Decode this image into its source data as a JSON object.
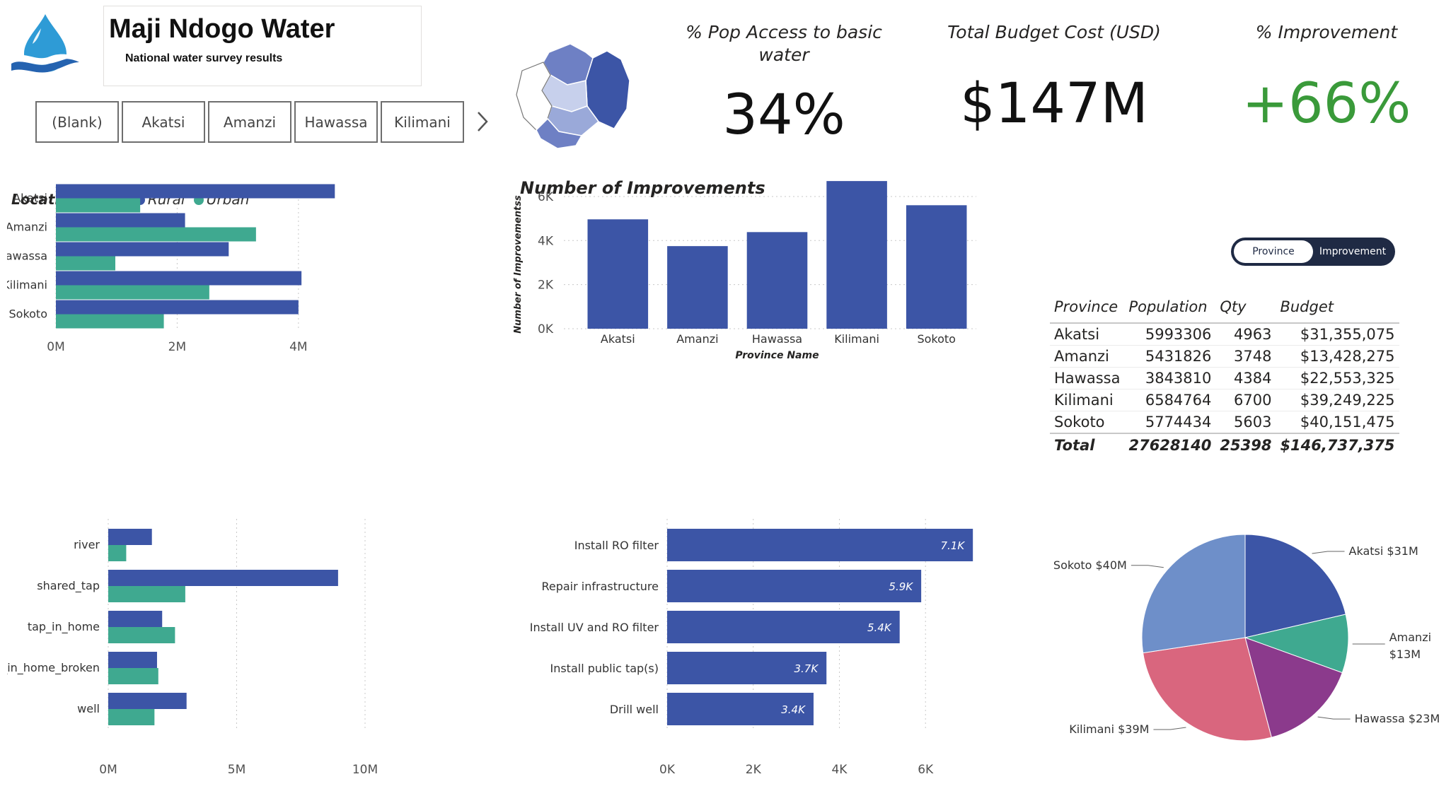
{
  "header": {
    "title": "Maji Ndogo Water",
    "subtitle": "National water survey results",
    "logo_icon": "water-drop-icon"
  },
  "slicer": {
    "items": [
      "(Blank)",
      "Akatsi",
      "Amanzi",
      "Hawassa",
      "Kilimani"
    ],
    "next_icon": "chevron-right-icon"
  },
  "kpis": {
    "access_label": "% Pop Access to basic water",
    "access_value": "34%",
    "budget_label": "Total Budget Cost (USD)",
    "budget_value": "$147M",
    "improvement_label": "% Improvement",
    "improvement_value": "+66%"
  },
  "legend": {
    "title": "Location Type",
    "items": [
      {
        "label": "Rural",
        "color": "#3c55a6"
      },
      {
        "label": "Urban",
        "color": "#3fa990"
      }
    ]
  },
  "toggle": {
    "options": [
      "Province",
      "Improvement"
    ],
    "selected": "Province"
  },
  "table": {
    "columns": [
      "Province",
      "Population",
      "Qty",
      "Budget"
    ],
    "rows": [
      [
        "Akatsi",
        "5993306",
        "4963",
        "$31,355,075"
      ],
      [
        "Amanzi",
        "5431826",
        "3748",
        "$13,428,275"
      ],
      [
        "Hawassa",
        "3843810",
        "4384",
        "$22,553,325"
      ],
      [
        "Kilimani",
        "6584764",
        "6700",
        "$39,249,225"
      ],
      [
        "Sokoto",
        "5774434",
        "5603",
        "$40,151,475"
      ]
    ],
    "total": [
      "Total",
      "27628140",
      "25398",
      "$146,737,375"
    ]
  },
  "colors": {
    "rural": "#3c55a6",
    "urban": "#3fa990",
    "improvement_bar": "#3c55a6",
    "kpi_positive": "#3a9a3a"
  },
  "chart_data": [
    {
      "id": "population-by-province",
      "type": "bar",
      "orientation": "horizontal",
      "categories": [
        "Akatsi",
        "Amanzi",
        "Hawassa",
        "Kilimani",
        "Sokoto"
      ],
      "series": [
        {
          "name": "Rural",
          "values": [
            4600000,
            2130000,
            2850000,
            4050000,
            4000000
          ]
        },
        {
          "name": "Urban",
          "values": [
            1390000,
            3300000,
            980000,
            2530000,
            1780000
          ]
        }
      ],
      "xlim": [
        0,
        4900000
      ],
      "xticks": [
        0,
        2000000,
        4000000
      ],
      "xtick_labels": [
        "0M",
        "2M",
        "4M"
      ],
      "grid": true,
      "legend": "top-left"
    },
    {
      "id": "number-of-improvements",
      "type": "bar",
      "title": "Number of Improvements",
      "xlabel": "Province Name",
      "ylabel": "Number of Improvementss",
      "categories": [
        "Akatsi",
        "Amanzi",
        "Hawassa",
        "Kilimani",
        "Sokoto"
      ],
      "values": [
        4963,
        3748,
        4384,
        6700,
        5603
      ],
      "ylim": [
        0,
        6800
      ],
      "yticks": [
        0,
        2000,
        4000,
        6000
      ],
      "ytick_labels": [
        "0K",
        "2K",
        "4K",
        "6K"
      ],
      "grid": true
    },
    {
      "id": "population-by-source-type",
      "type": "bar",
      "orientation": "horizontal",
      "categories": [
        "river",
        "shared_tap",
        "tap_in_home",
        "tap_in_home_broken",
        "well"
      ],
      "series": [
        {
          "name": "Rural",
          "values": [
            1700000,
            8950000,
            2100000,
            1900000,
            3050000
          ]
        },
        {
          "name": "Urban",
          "values": [
            700000,
            3000000,
            2600000,
            1950000,
            1800000
          ]
        }
      ],
      "xlim": [
        0,
        10000000
      ],
      "xticks": [
        0,
        5000000,
        10000000
      ],
      "xtick_labels": [
        "0M",
        "5M",
        "10M"
      ],
      "grid": true
    },
    {
      "id": "improvement-types",
      "type": "bar",
      "orientation": "horizontal",
      "categories": [
        "Install RO filter",
        "Repair infrastructure",
        "Install UV and RO filter",
        "Install public tap(s)",
        "Drill well"
      ],
      "values": [
        7100,
        5900,
        5400,
        3700,
        3400
      ],
      "data_labels": [
        "7.1K",
        "5.9K",
        "5.4K",
        "3.7K",
        "3.4K"
      ],
      "xlim": [
        0,
        7500
      ],
      "xticks": [
        0,
        2000,
        4000,
        6000
      ],
      "xtick_labels": [
        "0K",
        "2K",
        "4K",
        "6K"
      ],
      "grid": true
    },
    {
      "id": "budget-by-province",
      "type": "pie",
      "categories": [
        "Akatsi",
        "Amanzi",
        "Hawassa",
        "Kilimani",
        "Sokoto"
      ],
      "values": [
        31355075,
        13428275,
        22553325,
        39249225,
        40151475
      ],
      "labels": [
        "Akatsi $31M",
        "Amanzi $13M",
        "Hawassa $23M",
        "Kilimani $39M",
        "Sokoto $40M"
      ],
      "colors": [
        "#3c55a6",
        "#3fa990",
        "#8b3a8c",
        "#d9667e",
        "#6e8fc9"
      ]
    }
  ]
}
